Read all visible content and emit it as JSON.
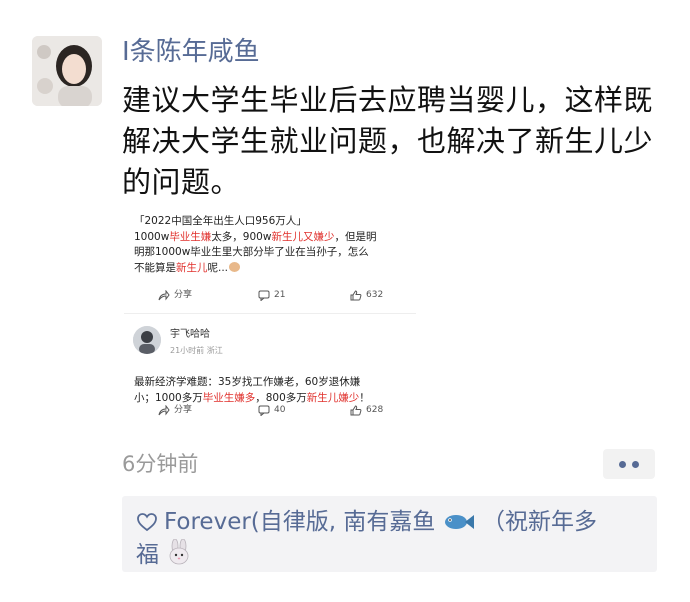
{
  "post": {
    "username": "I条陈年咸鱼",
    "text": "建议大学生毕业后去应聘当婴儿，这样既解决大学生就业问题，也解决了新生儿少的问题。",
    "time": "6分钟前"
  },
  "screenshot": {
    "line1": "「2022中国全年出生人口956万人」",
    "line2_a": "1000w",
    "line2_b": "毕业生嫌",
    "line2_c": "太多，900w",
    "line2_d": "新生儿又嫌少",
    "line2_e": "，但是明",
    "line3": "明那1000w毕业生里大部分毕了业在当孙子，怎么",
    "line4_a": "不能算是",
    "line4_b": "新生儿",
    "line4_c": "呢...",
    "actions1": {
      "share": "分享",
      "comments": "21",
      "likes": "632"
    },
    "comment": {
      "name": "宇飞哈哈",
      "meta": "21小时前  浙江",
      "line1": "最新经济学难题：35岁找工作嫌老，60岁退休嫌",
      "line2_a": "小；1000多万",
      "line2_b": "毕业生嫌多",
      "line2_c": "，800多万",
      "line2_d": "新生儿嫌少",
      "line2_e": "！"
    },
    "actions2": {
      "share": "分享",
      "comments": "40",
      "likes": "628"
    }
  },
  "likes": {
    "text_a": "Forever(自律版, 南有嘉鱼",
    "text_b": "（祝新年多",
    "text_c": "福"
  },
  "colors": {
    "link": "#576b95",
    "highlight": "#e0302c",
    "time": "#9a9a9a"
  },
  "icons": [
    "heart-icon",
    "fish-emoji-icon",
    "rabbit-emoji-icon",
    "more-dots-icon",
    "share-icon",
    "comment-icon",
    "thumbs-up-icon"
  ]
}
